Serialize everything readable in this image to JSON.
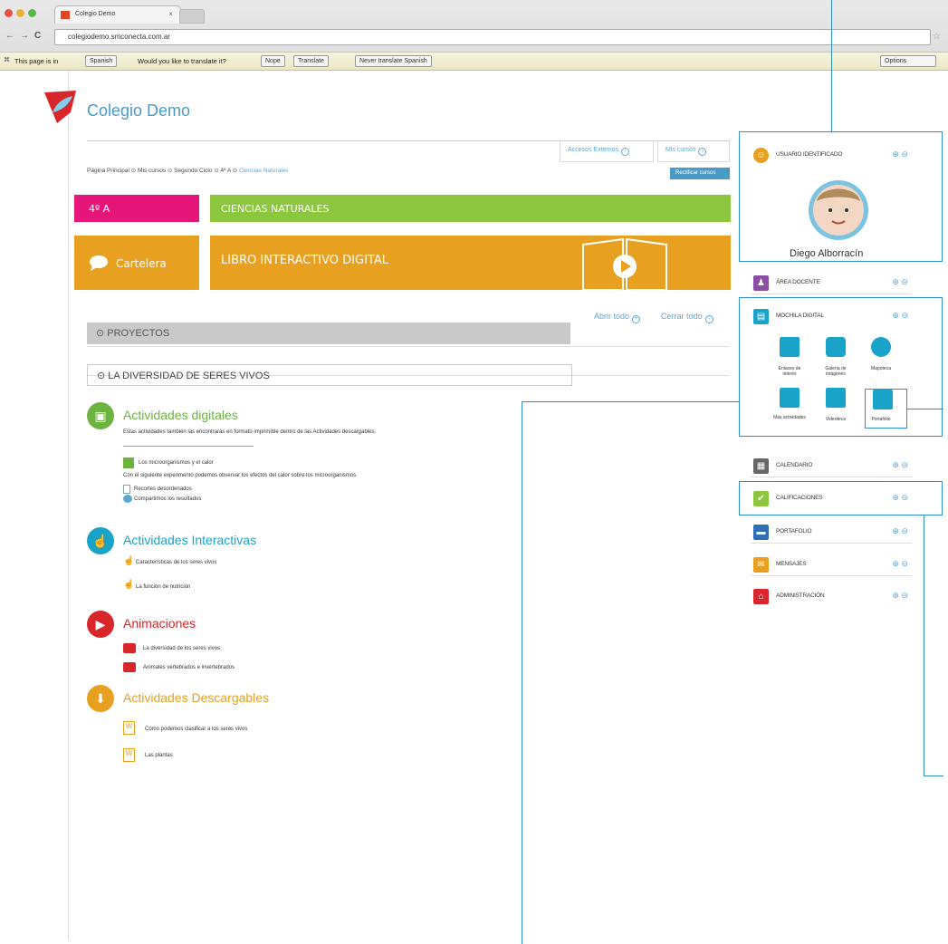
{
  "browser": {
    "tab_title": "Colegio Demo",
    "tab_close": "×",
    "url": "colegiodemo.smconecta.com.ar",
    "nav_back": "←",
    "nav_forward": "→",
    "nav_reload": "C",
    "translate_text": "This page is in",
    "translate_lang": "Spanish",
    "translate_question": "Would you like to translate it?",
    "nope": "Nope",
    "translate": "Translate",
    "never": "Never translate Spanish",
    "options": "Options"
  },
  "site": {
    "name": "Colegio Demo",
    "links": {
      "accesos": "Accesos Externos",
      "mis_cursos": "Mis cursos"
    },
    "breadcrumb": [
      "Página Principal",
      "Mis cursos",
      "Segundo Ciclo",
      "4º A",
      "Ciencias Naturales"
    ],
    "blue_button": "Rectificar cursos",
    "grade": "4º A",
    "subject": "CIENCIAS NATURALES",
    "cartelera": "Cartelera",
    "libro": "LIBRO INTERACTIVO DIGITAL",
    "abrir_todo": "Abrir todo",
    "cerrar_todo": "Cerrar todo",
    "proyectos": "PROYECTOS",
    "diversidad": "LA DIVERSIDAD DE SERES VIVOS"
  },
  "categories": {
    "digitales": {
      "title": "Actividades digitales",
      "desc": "Estas actividades también las encontrarás en formato imprimible dentro de las Actividades descargables.",
      "item": "Los microorganismos y el calor",
      "item_desc": "Con el siguiente experimento podemos observar los efectos del calor sobre los microorganismos.",
      "sub1": "Recortes desordenados",
      "sub2": "Compartimos los resultados"
    },
    "interactivas": {
      "title": "Actividades Interactivas",
      "items": [
        "Características de los seres vivos",
        "La función de nutrición"
      ]
    },
    "animaciones": {
      "title": "Animaciones",
      "items": [
        "La diversidad de los seres vivos",
        "Animales vertebrados e invertebrados"
      ]
    },
    "descargables": {
      "title": "Actividades Descargables",
      "items": [
        "Cómo podemos clasificar a los seres vivos",
        "Las plantas"
      ]
    }
  },
  "sidebar": {
    "usuario": "USUARIO IDENTIFICADO",
    "user_name": "Diego Alborracín",
    "items": [
      "ÁREA DOCENTE",
      "MOCHILA DIGITAL",
      "CALENDARIO",
      "CALIFICACIONES",
      "PORTAFOLIO",
      "MENSAJES",
      "ADMINISTRACIÓN"
    ],
    "mochila": [
      "Enlaces de interés",
      "Galería de imágenes",
      "Mapoteca",
      "Más actividades",
      "Videoteca",
      "Portafolio"
    ],
    "ctl": "⊕ ⊖"
  },
  "colors": {
    "magenta": "#e5157a",
    "green": "#8dc63f",
    "orange": "#e8a020",
    "blue": "#2f8fc6",
    "red": "#d9262a",
    "teal": "#1aa3c9",
    "purple": "#8b4ea6"
  }
}
